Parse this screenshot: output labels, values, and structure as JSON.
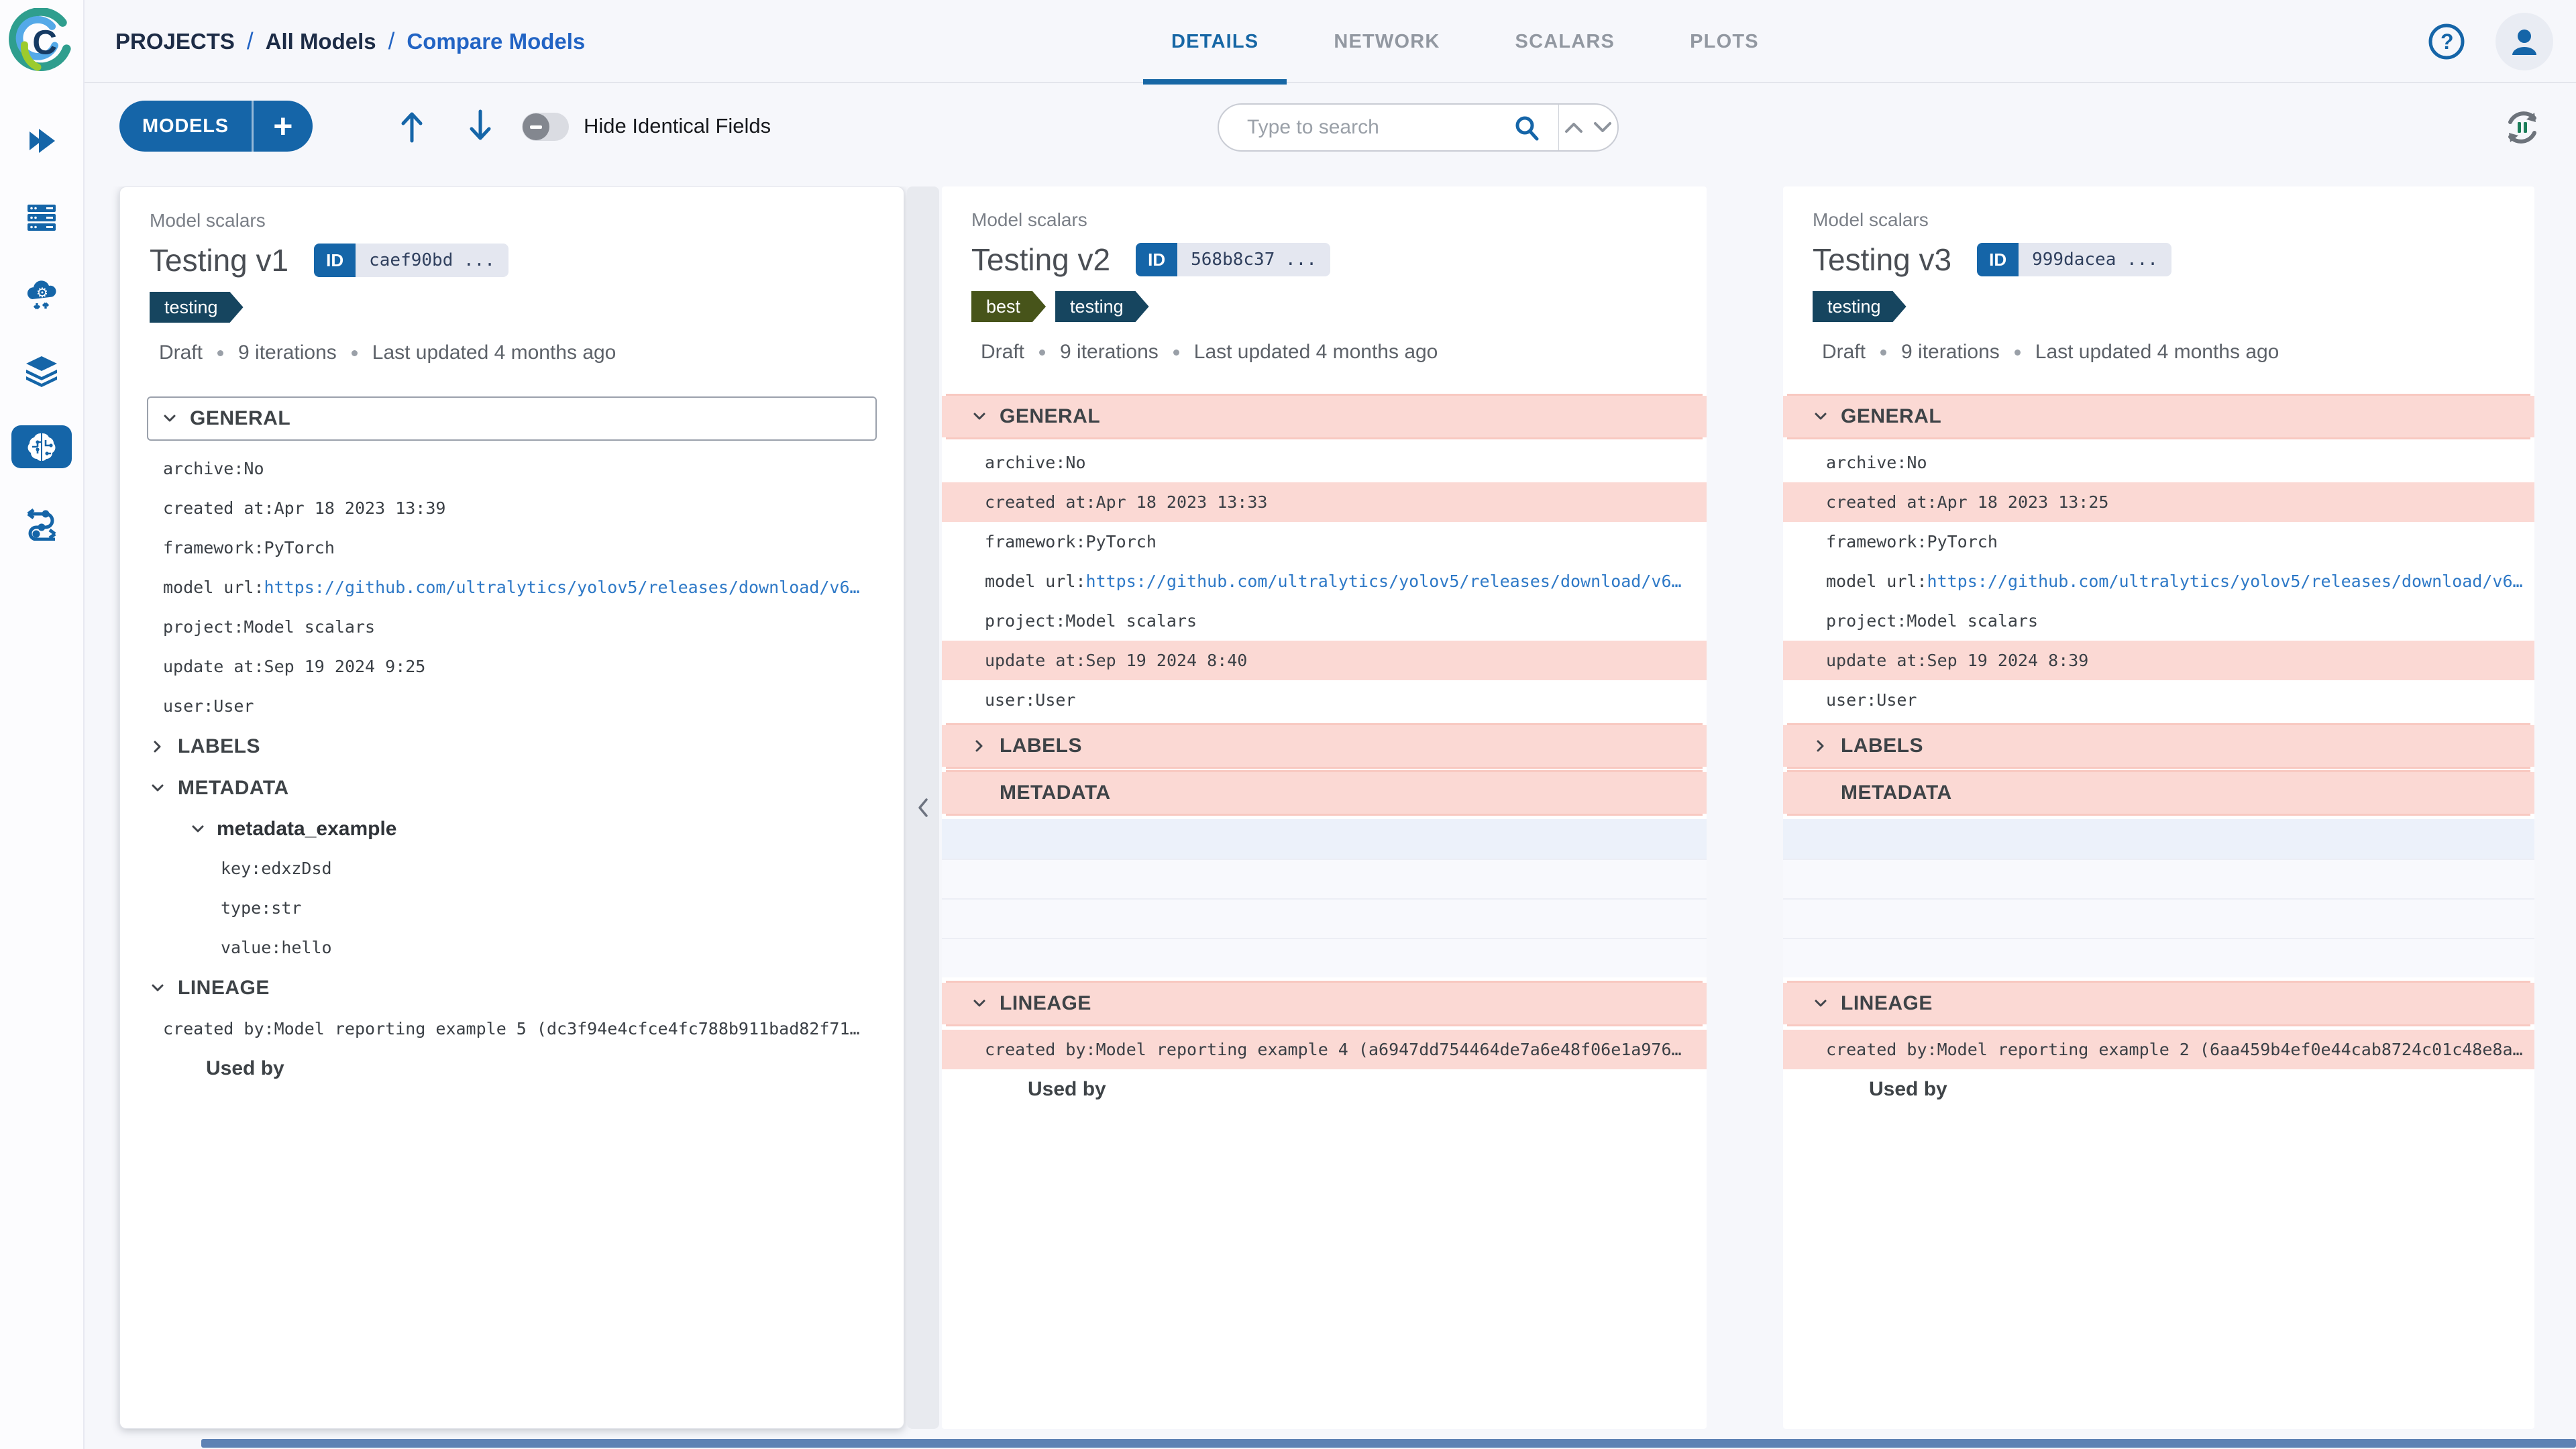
{
  "colors": {
    "primary": "#1565a8",
    "highlight": "#fbd9d4",
    "link": "#2e79c7",
    "tag_navy": "#16455f",
    "tag_green": "#47541a"
  },
  "kv_separator": " : ",
  "breadcrumb": {
    "items": [
      "PROJECTS",
      "All Models",
      "Compare Models"
    ],
    "separator": "/"
  },
  "tabs": [
    {
      "label": "DETAILS",
      "active": true
    },
    {
      "label": "NETWORK",
      "active": false
    },
    {
      "label": "SCALARS",
      "active": false
    },
    {
      "label": "PLOTS",
      "active": false
    }
  ],
  "toolbar": {
    "models_label": "MODELS",
    "add_label": "+",
    "hide_identical_label": "Hide Identical Fields",
    "search_placeholder": "Type to search"
  },
  "columns": [
    {
      "project_label": "Model scalars",
      "name": "Testing v1",
      "id_badge": {
        "label": "ID",
        "value": "caef90bd ..."
      },
      "tags": [
        {
          "label": "testing",
          "color": "#16455f"
        }
      ],
      "status": [
        "Draft",
        "9 iterations",
        "Last updated 4 months ago"
      ],
      "pinned": true,
      "sections": {
        "general": {
          "title": "GENERAL",
          "expanded": true,
          "boxed": true,
          "highlight": false,
          "rows": [
            {
              "key": "archive",
              "value": "No"
            },
            {
              "key": "created at",
              "value": "Apr 18 2023 13:39"
            },
            {
              "key": "framework",
              "value": "PyTorch"
            },
            {
              "key": "model url",
              "value": "https://github.com/ultralytics/yolov5/releases/download/v6…",
              "link": true
            },
            {
              "key": "project",
              "value": "Model scalars"
            },
            {
              "key": "update at",
              "value": "Sep 19 2024 9:25"
            },
            {
              "key": "user",
              "value": "User"
            }
          ]
        },
        "labels": {
          "title": "LABELS",
          "collapsed": true,
          "highlight": false
        },
        "metadata": {
          "title": "METADATA",
          "highlight": false,
          "group": {
            "name": "metadata_example",
            "rows": [
              {
                "key": "key",
                "value": "edxzDsd"
              },
              {
                "key": "type",
                "value": "str"
              },
              {
                "key": "value",
                "value": "hello"
              }
            ]
          }
        },
        "lineage": {
          "title": "LINEAGE",
          "highlight": false,
          "rows": [
            {
              "key": "created by",
              "value": "Model reporting example 5 (dc3f94e4cfce4fc788b911bad82f71…",
              "highlight": false
            }
          ],
          "used_by_label": "Used by"
        }
      }
    },
    {
      "project_label": "Model scalars",
      "name": "Testing v2",
      "id_badge": {
        "label": "ID",
        "value": "568b8c37 ..."
      },
      "tags": [
        {
          "label": "best",
          "color": "#47541a"
        },
        {
          "label": "testing",
          "color": "#16455f"
        }
      ],
      "status": [
        "Draft",
        "9 iterations",
        "Last updated 4 months ago"
      ],
      "pinned": false,
      "sections": {
        "general": {
          "title": "GENERAL",
          "expanded": true,
          "boxed": false,
          "highlight": true,
          "rows": [
            {
              "key": "archive",
              "value": "No"
            },
            {
              "key": "created at",
              "value": "Apr 18 2023 13:33",
              "highlight": true
            },
            {
              "key": "framework",
              "value": "PyTorch"
            },
            {
              "key": "model url",
              "value": "https://github.com/ultralytics/yolov5/releases/download/v6…",
              "link": true
            },
            {
              "key": "project",
              "value": "Model scalars"
            },
            {
              "key": "update at",
              "value": "Sep 19 2024 8:40",
              "highlight": true
            },
            {
              "key": "user",
              "value": "User"
            }
          ]
        },
        "labels": {
          "title": "LABELS",
          "collapsed": true,
          "highlight": true
        },
        "metadata": {
          "title": "METADATA",
          "highlight": true,
          "placeholder_rows": 4
        },
        "lineage": {
          "title": "LINEAGE",
          "highlight": true,
          "rows": [
            {
              "key": "created by",
              "value": "Model reporting example 4 (a6947dd754464de7a6e48f06e1a976…",
              "highlight": true
            }
          ],
          "used_by_label": "Used by"
        }
      }
    },
    {
      "project_label": "Model scalars",
      "name": "Testing v3",
      "id_badge": {
        "label": "ID",
        "value": "999dacea ..."
      },
      "tags": [
        {
          "label": "testing",
          "color": "#16455f"
        }
      ],
      "status": [
        "Draft",
        "9 iterations",
        "Last updated 4 months ago"
      ],
      "pinned": false,
      "sections": {
        "general": {
          "title": "GENERAL",
          "expanded": true,
          "boxed": false,
          "highlight": true,
          "rows": [
            {
              "key": "archive",
              "value": "No"
            },
            {
              "key": "created at",
              "value": "Apr 18 2023 13:25",
              "highlight": true
            },
            {
              "key": "framework",
              "value": "PyTorch"
            },
            {
              "key": "model url",
              "value": "https://github.com/ultralytics/yolov5/releases/download/v6…",
              "link": true
            },
            {
              "key": "project",
              "value": "Model scalars"
            },
            {
              "key": "update at",
              "value": "Sep 19 2024 8:39",
              "highlight": true
            },
            {
              "key": "user",
              "value": "User"
            }
          ]
        },
        "labels": {
          "title": "LABELS",
          "collapsed": true,
          "highlight": true
        },
        "metadata": {
          "title": "METADATA",
          "highlight": true,
          "placeholder_rows": 4
        },
        "lineage": {
          "title": "LINEAGE",
          "highlight": true,
          "rows": [
            {
              "key": "created by",
              "value": "Model reporting example 2 (6aa459b4ef0e44cab8724c01c48e8a…",
              "highlight": true
            }
          ],
          "used_by_label": "Used by"
        }
      }
    }
  ]
}
